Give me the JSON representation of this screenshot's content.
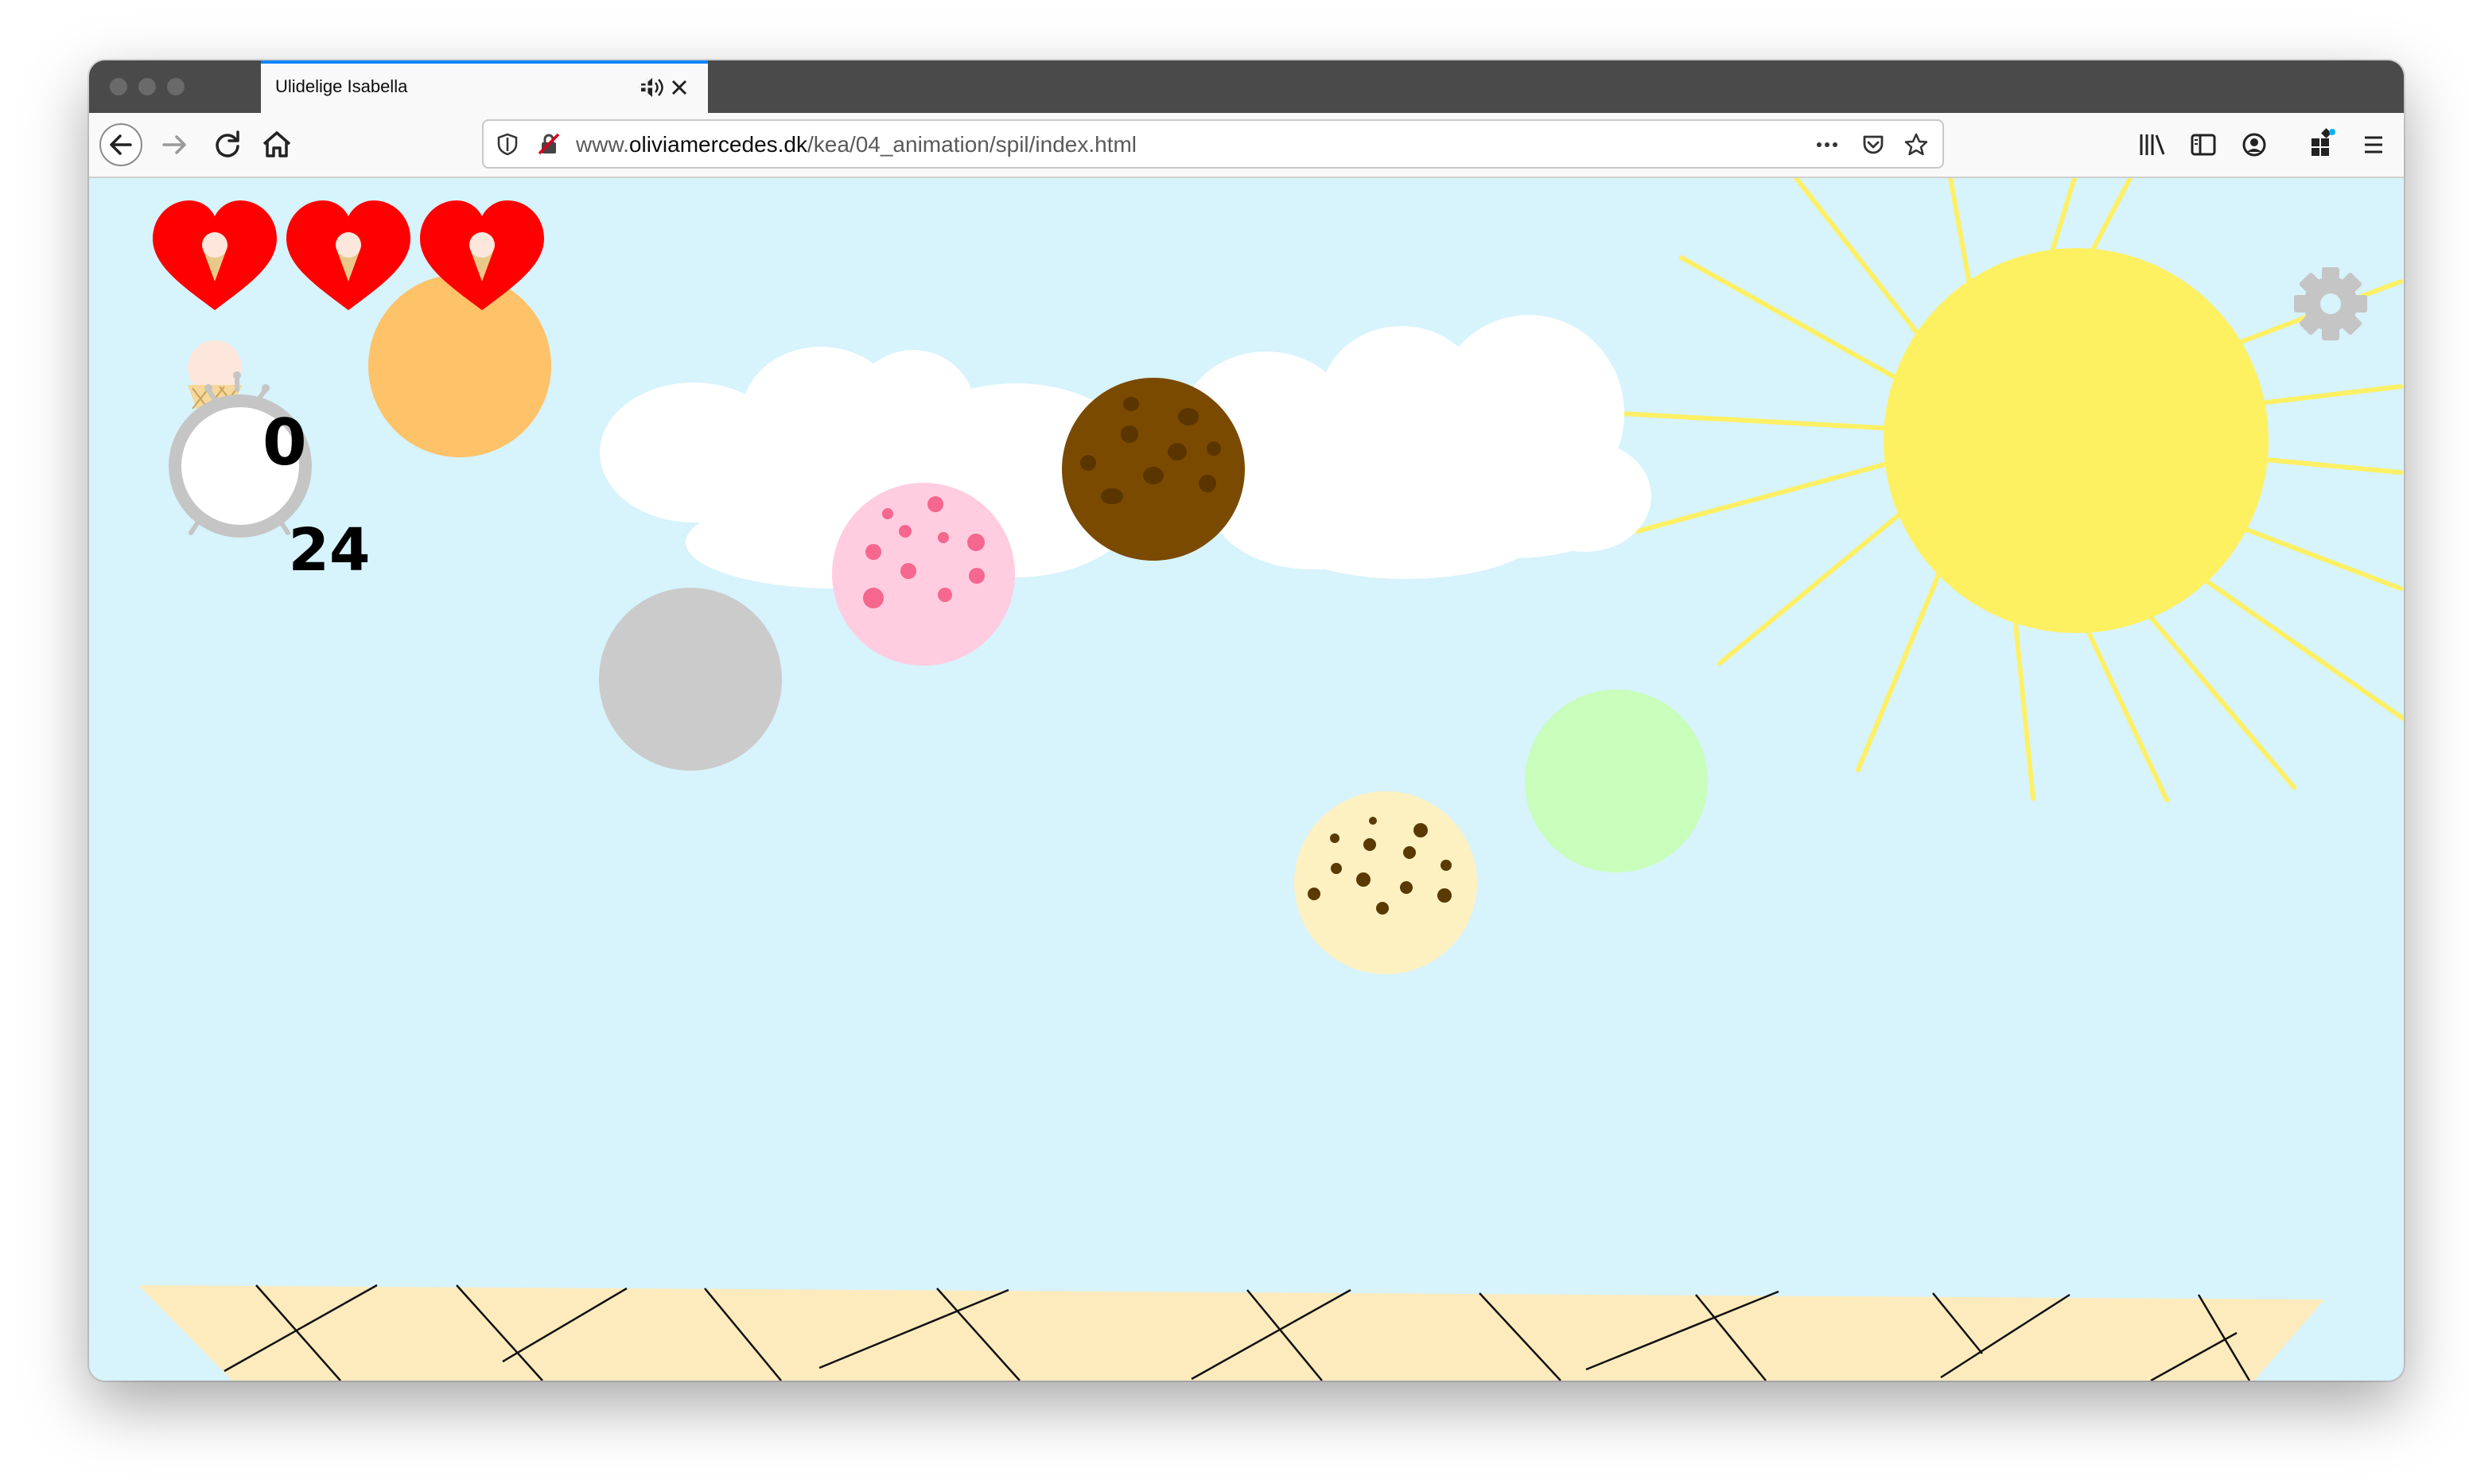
{
  "browser": {
    "tab_title": "Ulidelige Isabella",
    "url_prefix": "www.",
    "url_domain": "oliviamercedes.dk",
    "url_path": "/kea/04_animation/spil/index.html",
    "tab_accent": "#0a84ff"
  },
  "game": {
    "lives": 3,
    "score": "0",
    "timer": "24",
    "icons": [
      "heart-cone-icon",
      "ice-cream-cone-icon",
      "alarm-clock-icon",
      "gear-icon",
      "sun",
      "clouds",
      "waffle-cone"
    ],
    "scoops": [
      {
        "flavor": "orange",
        "color": "#fec268"
      },
      {
        "flavor": "grey",
        "color": "#cbcbcb"
      },
      {
        "flavor": "strawberry",
        "color": "#ffcce0"
      },
      {
        "flavor": "chocolate",
        "color": "#7a4a00"
      },
      {
        "flavor": "mint",
        "color": "#c9fdbb"
      },
      {
        "flavor": "cookie-dough",
        "color": "#fdf1c2"
      }
    ],
    "colors": {
      "sky": "#d7f3fc",
      "sun": "#fef161",
      "heart": "#ff0000",
      "cone": "#fdebbd"
    }
  }
}
